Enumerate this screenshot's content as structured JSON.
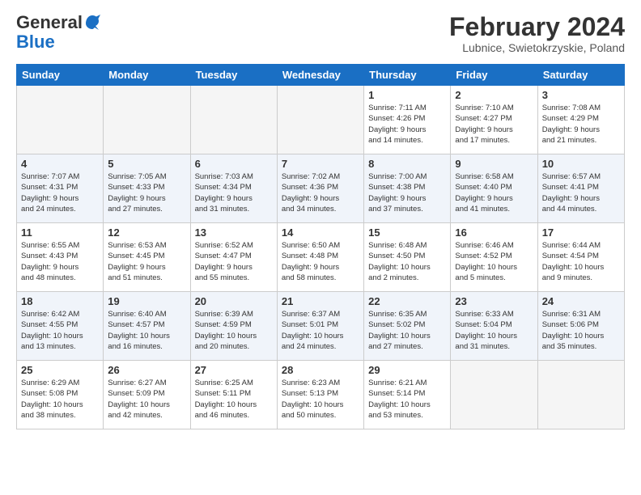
{
  "header": {
    "logo_general": "General",
    "logo_blue": "Blue",
    "month_title": "February 2024",
    "location": "Lubnice, Swietokrzyskie, Poland"
  },
  "weekdays": [
    "Sunday",
    "Monday",
    "Tuesday",
    "Wednesday",
    "Thursday",
    "Friday",
    "Saturday"
  ],
  "weeks": [
    [
      {
        "day": "",
        "info": ""
      },
      {
        "day": "",
        "info": ""
      },
      {
        "day": "",
        "info": ""
      },
      {
        "day": "",
        "info": ""
      },
      {
        "day": "1",
        "info": "Sunrise: 7:11 AM\nSunset: 4:26 PM\nDaylight: 9 hours\nand 14 minutes."
      },
      {
        "day": "2",
        "info": "Sunrise: 7:10 AM\nSunset: 4:27 PM\nDaylight: 9 hours\nand 17 minutes."
      },
      {
        "day": "3",
        "info": "Sunrise: 7:08 AM\nSunset: 4:29 PM\nDaylight: 9 hours\nand 21 minutes."
      }
    ],
    [
      {
        "day": "4",
        "info": "Sunrise: 7:07 AM\nSunset: 4:31 PM\nDaylight: 9 hours\nand 24 minutes."
      },
      {
        "day": "5",
        "info": "Sunrise: 7:05 AM\nSunset: 4:33 PM\nDaylight: 9 hours\nand 27 minutes."
      },
      {
        "day": "6",
        "info": "Sunrise: 7:03 AM\nSunset: 4:34 PM\nDaylight: 9 hours\nand 31 minutes."
      },
      {
        "day": "7",
        "info": "Sunrise: 7:02 AM\nSunset: 4:36 PM\nDaylight: 9 hours\nand 34 minutes."
      },
      {
        "day": "8",
        "info": "Sunrise: 7:00 AM\nSunset: 4:38 PM\nDaylight: 9 hours\nand 37 minutes."
      },
      {
        "day": "9",
        "info": "Sunrise: 6:58 AM\nSunset: 4:40 PM\nDaylight: 9 hours\nand 41 minutes."
      },
      {
        "day": "10",
        "info": "Sunrise: 6:57 AM\nSunset: 4:41 PM\nDaylight: 9 hours\nand 44 minutes."
      }
    ],
    [
      {
        "day": "11",
        "info": "Sunrise: 6:55 AM\nSunset: 4:43 PM\nDaylight: 9 hours\nand 48 minutes."
      },
      {
        "day": "12",
        "info": "Sunrise: 6:53 AM\nSunset: 4:45 PM\nDaylight: 9 hours\nand 51 minutes."
      },
      {
        "day": "13",
        "info": "Sunrise: 6:52 AM\nSunset: 4:47 PM\nDaylight: 9 hours\nand 55 minutes."
      },
      {
        "day": "14",
        "info": "Sunrise: 6:50 AM\nSunset: 4:48 PM\nDaylight: 9 hours\nand 58 minutes."
      },
      {
        "day": "15",
        "info": "Sunrise: 6:48 AM\nSunset: 4:50 PM\nDaylight: 10 hours\nand 2 minutes."
      },
      {
        "day": "16",
        "info": "Sunrise: 6:46 AM\nSunset: 4:52 PM\nDaylight: 10 hours\nand 5 minutes."
      },
      {
        "day": "17",
        "info": "Sunrise: 6:44 AM\nSunset: 4:54 PM\nDaylight: 10 hours\nand 9 minutes."
      }
    ],
    [
      {
        "day": "18",
        "info": "Sunrise: 6:42 AM\nSunset: 4:55 PM\nDaylight: 10 hours\nand 13 minutes."
      },
      {
        "day": "19",
        "info": "Sunrise: 6:40 AM\nSunset: 4:57 PM\nDaylight: 10 hours\nand 16 minutes."
      },
      {
        "day": "20",
        "info": "Sunrise: 6:39 AM\nSunset: 4:59 PM\nDaylight: 10 hours\nand 20 minutes."
      },
      {
        "day": "21",
        "info": "Sunrise: 6:37 AM\nSunset: 5:01 PM\nDaylight: 10 hours\nand 24 minutes."
      },
      {
        "day": "22",
        "info": "Sunrise: 6:35 AM\nSunset: 5:02 PM\nDaylight: 10 hours\nand 27 minutes."
      },
      {
        "day": "23",
        "info": "Sunrise: 6:33 AM\nSunset: 5:04 PM\nDaylight: 10 hours\nand 31 minutes."
      },
      {
        "day": "24",
        "info": "Sunrise: 6:31 AM\nSunset: 5:06 PM\nDaylight: 10 hours\nand 35 minutes."
      }
    ],
    [
      {
        "day": "25",
        "info": "Sunrise: 6:29 AM\nSunset: 5:08 PM\nDaylight: 10 hours\nand 38 minutes."
      },
      {
        "day": "26",
        "info": "Sunrise: 6:27 AM\nSunset: 5:09 PM\nDaylight: 10 hours\nand 42 minutes."
      },
      {
        "day": "27",
        "info": "Sunrise: 6:25 AM\nSunset: 5:11 PM\nDaylight: 10 hours\nand 46 minutes."
      },
      {
        "day": "28",
        "info": "Sunrise: 6:23 AM\nSunset: 5:13 PM\nDaylight: 10 hours\nand 50 minutes."
      },
      {
        "day": "29",
        "info": "Sunrise: 6:21 AM\nSunset: 5:14 PM\nDaylight: 10 hours\nand 53 minutes."
      },
      {
        "day": "",
        "info": ""
      },
      {
        "day": "",
        "info": ""
      }
    ]
  ]
}
